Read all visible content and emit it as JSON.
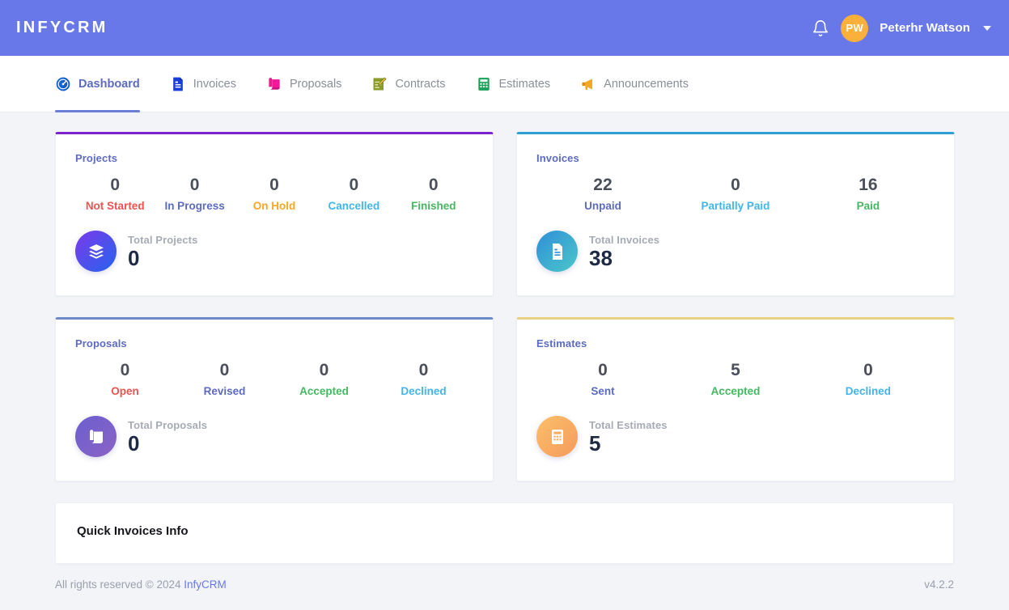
{
  "header": {
    "brand": "INFYCRM",
    "bell_icon": "bell-icon",
    "user": {
      "initials": "PW",
      "name": "Peterhr Watson"
    },
    "bg_color": "#6878e8"
  },
  "nav": {
    "items": [
      {
        "label": "Dashboard",
        "icon": "speedometer-icon",
        "active": true
      },
      {
        "label": "Invoices",
        "icon": "document-icon",
        "active": false
      },
      {
        "label": "Proposals",
        "icon": "scroll-icon",
        "active": false
      },
      {
        "label": "Contracts",
        "icon": "memo-pen-icon",
        "active": false
      },
      {
        "label": "Estimates",
        "icon": "calculator-icon",
        "active": false
      },
      {
        "label": "Announcements",
        "icon": "megaphone-icon",
        "active": false
      }
    ],
    "active_indicator_color": "#6b7fd7"
  },
  "cards": [
    {
      "title": "Projects",
      "accent_color": "#7e22ce",
      "icon": "layers-icon",
      "icon_gradient": [
        "#7c3aed",
        "#2563eb"
      ],
      "stats": [
        {
          "value": "0",
          "label": "Not Started",
          "color": "#ef5350"
        },
        {
          "value": "0",
          "label": "In Progress",
          "color": "#5c6bc0"
        },
        {
          "value": "0",
          "label": "On Hold",
          "color": "#f5a623"
        },
        {
          "value": "0",
          "label": "Cancelled",
          "color": "#42b6e8"
        },
        {
          "value": "0",
          "label": "Finished",
          "color": "#45b863"
        }
      ],
      "total_label": "Total Projects",
      "total_value": "0"
    },
    {
      "title": "Invoices",
      "accent_color": "#2f9ed4",
      "icon": "invoice-document-icon",
      "icon_gradient": [
        "#2f8fd8",
        "#4bc7c9"
      ],
      "stats": [
        {
          "value": "22",
          "label": "Unpaid",
          "color": "#5c6bc0"
        },
        {
          "value": "0",
          "label": "Partially Paid",
          "color": "#42b6e8"
        },
        {
          "value": "16",
          "label": "Paid",
          "color": "#45b863"
        }
      ],
      "total_label": "Total Invoices",
      "total_value": "38"
    },
    {
      "title": "Proposals",
      "accent_color": "#6c8bc7",
      "icon": "scroll-icon",
      "icon_gradient": [
        "#6b5fd0",
        "#8b63c4"
      ],
      "stats": [
        {
          "value": "0",
          "label": "Open",
          "color": "#ef5350"
        },
        {
          "value": "0",
          "label": "Revised",
          "color": "#5c6bc0"
        },
        {
          "value": "0",
          "label": "Accepted",
          "color": "#45b863"
        },
        {
          "value": "0",
          "label": "Declined",
          "color": "#42b6e8"
        }
      ],
      "total_label": "Total Proposals",
      "total_value": "0"
    },
    {
      "title": "Estimates",
      "accent_color": "#e8d183",
      "icon": "calculator-icon",
      "icon_gradient": [
        "#fbc06a",
        "#f59a5c"
      ],
      "stats": [
        {
          "value": "0",
          "label": "Sent",
          "color": "#5c6bc0"
        },
        {
          "value": "5",
          "label": "Accepted",
          "color": "#45b863"
        },
        {
          "value": "0",
          "label": "Declined",
          "color": "#42b6e8"
        }
      ],
      "total_label": "Total Estimates",
      "total_value": "5"
    }
  ],
  "quick_panel": {
    "title": "Quick Invoices Info"
  },
  "footer": {
    "text": "All rights reserved © 2024",
    "link": "InfyCRM",
    "version": "v4.2.2"
  }
}
